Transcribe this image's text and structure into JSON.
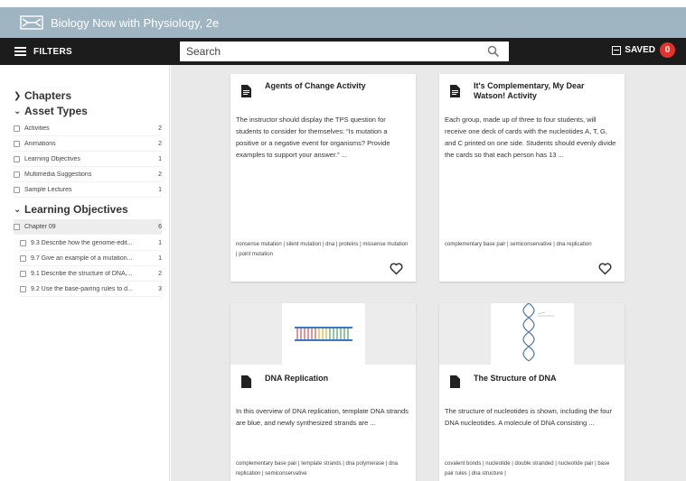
{
  "app": {
    "title": "Biology Now with Physiology, 2e"
  },
  "toolbar": {
    "filters_label": "FILTERS",
    "search": {
      "placeholder": "Search",
      "value": ""
    },
    "saved_label": "SAVED",
    "saved_count": "0"
  },
  "sidebar": {
    "chapters_label": "Chapters",
    "asset_types_label": "Asset Types",
    "asset_types": [
      {
        "label": "Activities",
        "count": "2"
      },
      {
        "label": "Animations",
        "count": "2"
      },
      {
        "label": "Learning Objectives",
        "count": "1"
      },
      {
        "label": "Multimedia Suggestions",
        "count": "2"
      },
      {
        "label": "Sample Lectures",
        "count": "1"
      }
    ],
    "learning_objectives_label": "Learning Objectives",
    "chapter_group": {
      "label": "Chapter 09",
      "count": "6"
    },
    "objectives": [
      {
        "label": "9.3 Describe how the genome-edit...",
        "count": "1"
      },
      {
        "label": "9.7 Give an example of a mutation...",
        "count": "1"
      },
      {
        "label": "9.1 Describe the structure of DNA,...",
        "count": "2"
      },
      {
        "label": "9.2 Use the base-pairing rules to d...",
        "count": "3"
      }
    ]
  },
  "cards": [
    {
      "title": "Agents of Change Activity",
      "description": "The instructor should display the TPS question for students to consider for themselves: “Is mutation a positive or a negative event for organisms? Provide examples to support your answer.” ...",
      "tags": "nonsense mutation | silent mutation | dna | proteins | missense mutation | point mutation"
    },
    {
      "title": "It's Complementary, My Dear Watson! Activity",
      "description": "Each group, made up of three to four students, will receive one deck of cards with the nucleotides A, T, G, and C printed on one side. Students should evenly divide the cards so that each person has 13 ...",
      "tags": "complementary base pair | semiconservative | dna replication"
    },
    {
      "title": "DNA Replication",
      "description": "In this overview of DNA replication, template DNA strands are blue, and newly synthesized strands are ...",
      "tags": "complementary base pair | template strands | dna polymerase | dna replication | semiconservative"
    },
    {
      "title": "The Structure of DNA",
      "description": "The structure of nucleotides is shown, including the four DNA nucleotides. A molecule of DNA consisting ...",
      "tags": "covalent bonds | nucleotide | double stranded | nucleotide pair | base pair rules | dna structure |"
    }
  ],
  "colors": {
    "titlebar": "#9fb5c2",
    "toolbar": "#1c1c1c",
    "badge": "#e2332a",
    "main_bg": "#e9e9e9"
  }
}
